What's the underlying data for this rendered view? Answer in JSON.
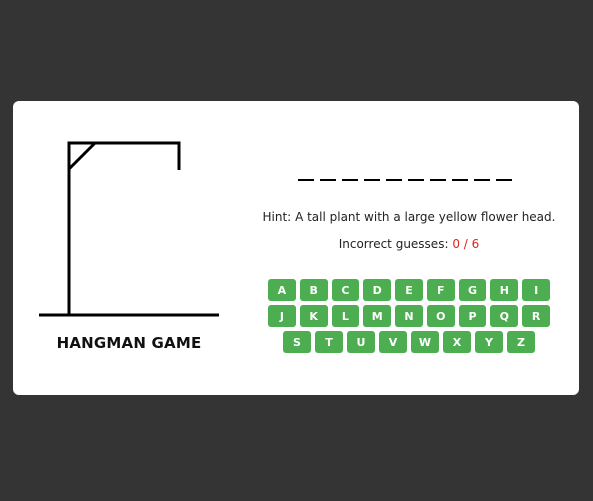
{
  "title": "HANGMAN GAME",
  "word": {
    "length": 10,
    "revealed": [
      "",
      "",
      "",
      "",
      "",
      "",
      "",
      "",
      "",
      ""
    ]
  },
  "hint": {
    "label": "Hint:",
    "text": "A tall plant with a large yellow flower head."
  },
  "guesses": {
    "label": "Incorrect guesses:",
    "count_text": "0 / 6",
    "incorrect": 0,
    "max": 6
  },
  "keyboard": {
    "rows": [
      [
        "A",
        "B",
        "C",
        "D",
        "E",
        "F",
        "G",
        "H",
        "I"
      ],
      [
        "J",
        "K",
        "L",
        "M",
        "N",
        "O",
        "P",
        "Q",
        "R"
      ],
      [
        "S",
        "T",
        "U",
        "V",
        "W",
        "X",
        "Y",
        "Z"
      ]
    ]
  },
  "colors": {
    "background": "#343434",
    "card": "#ffffff",
    "key": "#4cae50",
    "count": "#e0241b"
  }
}
